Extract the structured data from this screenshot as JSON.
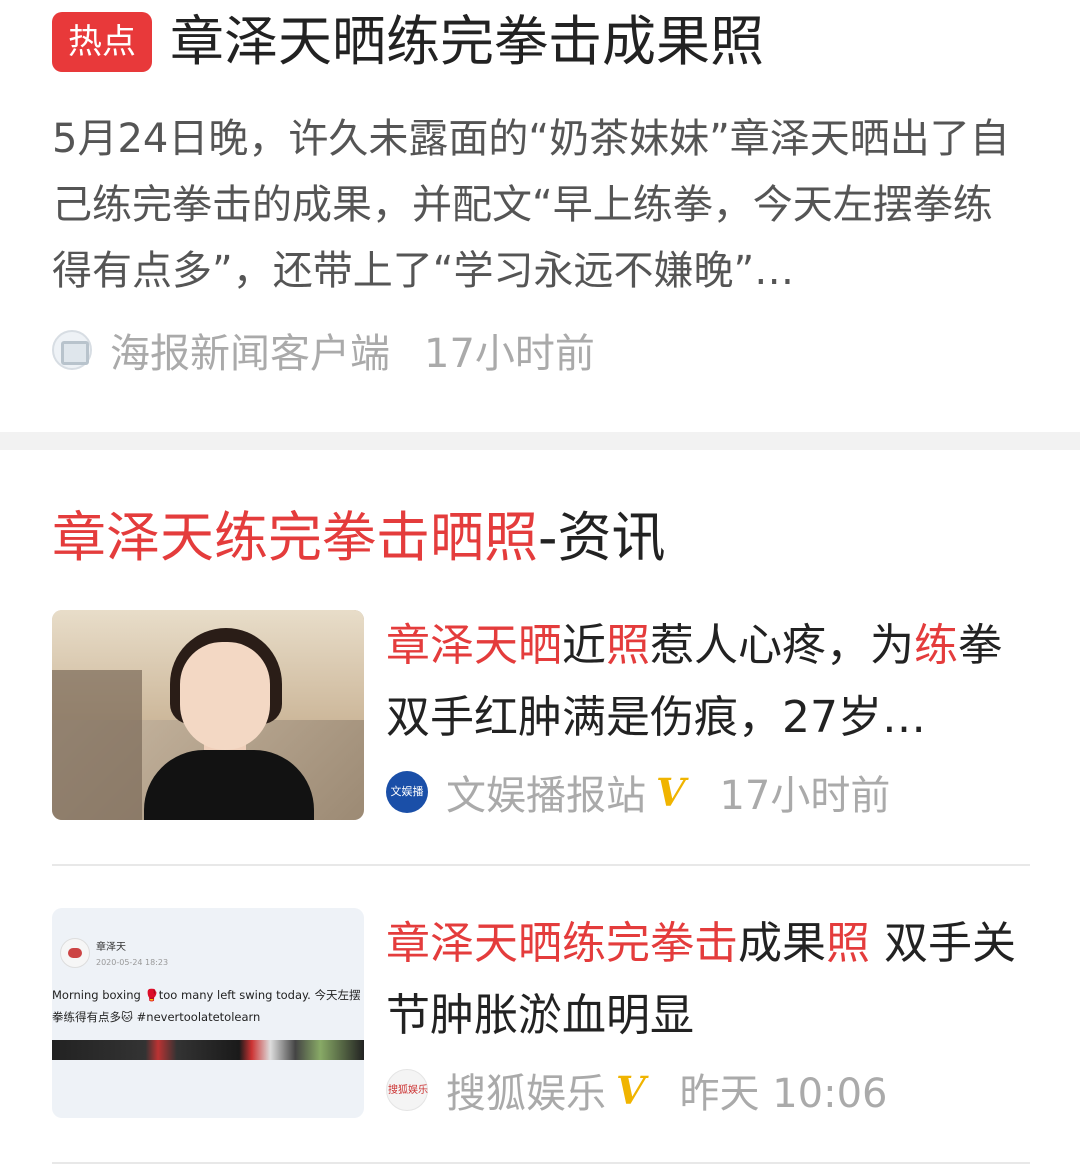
{
  "hot": {
    "badge": "热点",
    "title": "章泽天晒练完拳击成果照",
    "summary": "5月24日晚，许久未露面的“奶茶妹妹”章泽天晒出了自己练完拳击的成果，并配文“早上练拳，今天左摆拳练得有点多”，还带上了“学习永远不嫌晚”…",
    "source": "海报新闻客户端",
    "time": "17小时前"
  },
  "section": {
    "title_highlight": "章泽天练完拳击晒照",
    "title_suffix": "-资讯"
  },
  "items": [
    {
      "title_parts": [
        "章泽天晒",
        "近",
        "照",
        "惹人心疼，为",
        "练",
        "拳双手红肿满是伤痕，27岁…"
      ],
      "source": "文娱播报站",
      "source_logo_text": "文娱播报站",
      "verified_mark": "V",
      "time": "17小时前"
    },
    {
      "title_parts": [
        "章泽天晒练完拳击",
        "成果",
        "照",
        " 双手关节肿胀淤血明显"
      ],
      "source": "搜狐娱乐",
      "source_logo_text": "搜狐娱乐",
      "verified_mark": "V",
      "time": "昨天 10:06",
      "thumb": {
        "name": "章泽天",
        "date": "2020-05-24 18:23",
        "text": "Morning boxing 🥊too many left swing today. 今天左摆拳练得有点多🐱 #nevertoolatetolearn"
      }
    }
  ],
  "colors": {
    "accent_red": "#e43c3c",
    "badge_red": "#e8393a",
    "verified_gold": "#f0b400"
  }
}
